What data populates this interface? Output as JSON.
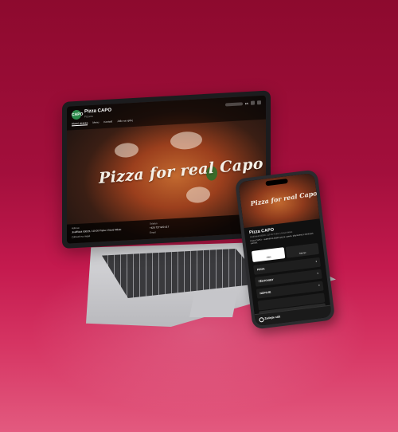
{
  "website": {
    "brand": "Pizza CAPO",
    "tagline": "Pizzeria",
    "nav": [
      "Hlavní stránka",
      "Menu",
      "Kontakt",
      "Jídlo na výdej"
    ],
    "language": "EN",
    "hero_text": "Pizza for real Capo",
    "footer": {
      "address_label": "Adresa",
      "address": "Jindřišská 930/26, 110 00 Praha 1-Nové Město",
      "map_link": "Zobrazit na mapě",
      "phone_label": "Telefon",
      "phone": "+420 727 920 417",
      "email_link": "Email"
    }
  },
  "phone_app": {
    "hero_text": "Pizza for real Capo",
    "title": "Pizza CAPO",
    "subtitle": "Jindřišská 930/26, 110 00 Praha 1-Nové Město",
    "description": "Pizza CAPO – autentická italská pizza z pece, připravená z čerstvých surovin.",
    "tabs": [
      "Jídlo",
      "Nápoje"
    ],
    "categories": [
      "PIZZA",
      "TĚSTOVINY",
      "NÁPOJE"
    ],
    "bottom_label": "Zadejte stůl"
  },
  "colors": {
    "background": "#a30f3c",
    "brand_green": "#2a8a4a"
  }
}
